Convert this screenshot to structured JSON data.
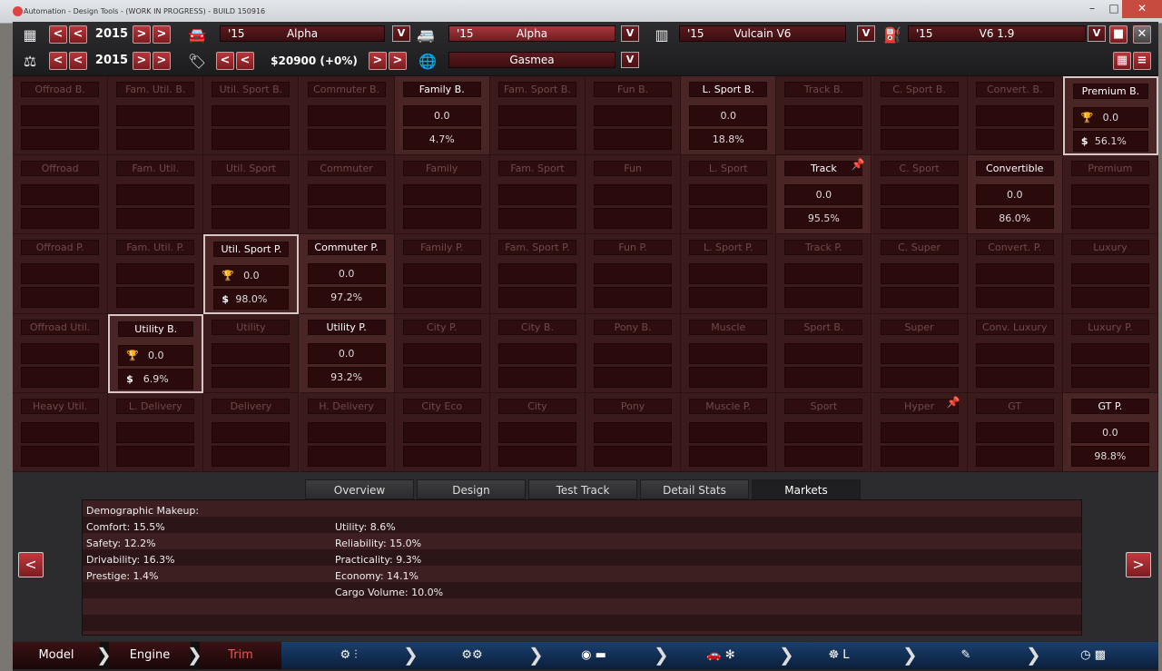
{
  "window": {
    "title": "Automation - Design Tools - (WORK IN PROGRESS) - BUILD 150916",
    "min": "–",
    "max": "□",
    "close": "✕"
  },
  "toolbar": {
    "year1": "2015",
    "year2": "2015",
    "price": "$20900 (+0%)",
    "model_year": "'15",
    "model_name": "Alpha",
    "trim_year": "'15",
    "trim_name": "Alpha",
    "engine_year": "'15",
    "engine_name": "Vulcain V6",
    "variant_year": "'15",
    "variant_name": "V6 1.9",
    "market": "Gasmea",
    "prev": "<",
    "next": ">",
    "dropdown": "V"
  },
  "grid": {
    "rows": [
      [
        {
          "label": "Offroad B."
        },
        {
          "label": "Fam. Util. B."
        },
        {
          "label": "Util. Sport B."
        },
        {
          "label": "Commuter B."
        },
        {
          "label": "Family B.",
          "active": true,
          "v1": "0.0",
          "v2": "4.7%"
        },
        {
          "label": "Fam. Sport B."
        },
        {
          "label": "Fun B."
        },
        {
          "label": "L. Sport B.",
          "active": true,
          "v1": "0.0",
          "v2": "18.8%"
        },
        {
          "label": "Track B."
        },
        {
          "label": "C. Sport B."
        },
        {
          "label": "Convert. B."
        },
        {
          "label": "Premium B.",
          "active": true,
          "sel": true,
          "v1": "0.0",
          "v2": "56.1%"
        }
      ],
      [
        {
          "label": "Offroad"
        },
        {
          "label": "Fam. Util."
        },
        {
          "label": "Util. Sport"
        },
        {
          "label": "Commuter"
        },
        {
          "label": "Family"
        },
        {
          "label": "Fam. Sport"
        },
        {
          "label": "Fun"
        },
        {
          "label": "L. Sport"
        },
        {
          "label": "Track",
          "active": true,
          "pin": true,
          "v1": "0.0",
          "v2": "95.5%"
        },
        {
          "label": "C. Sport"
        },
        {
          "label": "Convertible",
          "active": true,
          "v1": "0.0",
          "v2": "86.0%"
        },
        {
          "label": "Premium"
        }
      ],
      [
        {
          "label": "Offroad P."
        },
        {
          "label": "Fam. Util. P."
        },
        {
          "label": "Util. Sport P.",
          "active": true,
          "sel": true,
          "v1": "0.0",
          "v2": "98.0%"
        },
        {
          "label": "Commuter P.",
          "active": true,
          "v1": "0.0",
          "v2": "97.2%"
        },
        {
          "label": "Family P."
        },
        {
          "label": "Fam. Sport P."
        },
        {
          "label": "Fun P."
        },
        {
          "label": "L. Sport P."
        },
        {
          "label": "Track P."
        },
        {
          "label": "C. Super"
        },
        {
          "label": "Convert. P."
        },
        {
          "label": "Luxury"
        }
      ],
      [
        {
          "label": "Offroad Util."
        },
        {
          "label": "Utility B.",
          "active": true,
          "sel": true,
          "v1": "0.0",
          "v2": "6.9%"
        },
        {
          "label": "Utility"
        },
        {
          "label": "Utility P.",
          "active": true,
          "v1": "0.0",
          "v2": "93.2%"
        },
        {
          "label": "City P."
        },
        {
          "label": "City B."
        },
        {
          "label": "Pony B."
        },
        {
          "label": "Muscle"
        },
        {
          "label": "Sport B."
        },
        {
          "label": "Super"
        },
        {
          "label": "Conv. Luxury"
        },
        {
          "label": "Luxury P."
        }
      ],
      [
        {
          "label": "Heavy Util."
        },
        {
          "label": "L. Delivery"
        },
        {
          "label": "Delivery"
        },
        {
          "label": "H. Delivery"
        },
        {
          "label": "City Eco"
        },
        {
          "label": "City"
        },
        {
          "label": "Pony"
        },
        {
          "label": "Muscle P."
        },
        {
          "label": "Sport"
        },
        {
          "label": "Hyper",
          "pin": true
        },
        {
          "label": "GT"
        },
        {
          "label": "GT P.",
          "active": true,
          "v1": "0.0",
          "v2": "98.8%"
        }
      ]
    ]
  },
  "tabs": [
    "Overview",
    "Design",
    "Test Track",
    "Detail Stats",
    "Markets"
  ],
  "active_tab": "Markets",
  "demographics": {
    "heading": "Demographic Makeup:",
    "left": [
      "Comfort: 15.5%",
      "Safety: 12.2%",
      "Drivability: 16.3%",
      "Prestige: 1.4%"
    ],
    "right": [
      "Utility: 8.6%",
      "Reliability: 15.0%",
      "Practicality: 9.3%",
      "Economy: 14.1%",
      "Cargo Volume: 10.0%"
    ]
  },
  "nav": {
    "model": "Model",
    "engine": "Engine",
    "trim": "Trim"
  }
}
